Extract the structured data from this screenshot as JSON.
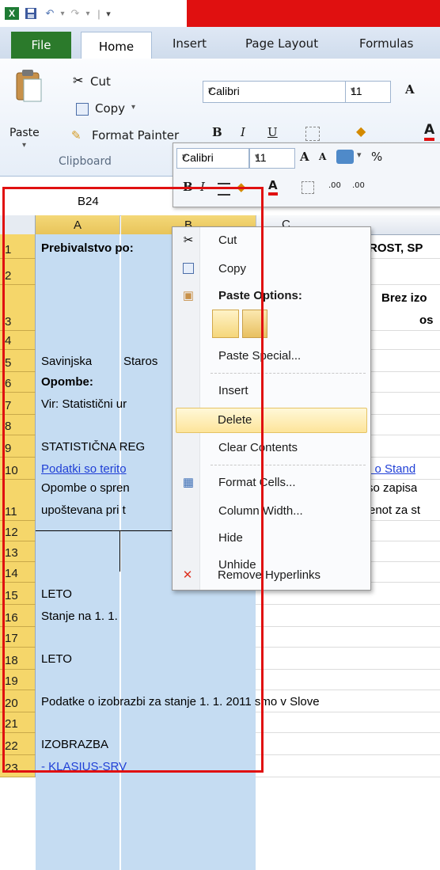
{
  "window": {
    "accent_red": "#e01010",
    "file_tab_color": "#2b7a2b"
  },
  "qat": {
    "icons": [
      "excel-app-icon",
      "save-icon",
      "undo-icon",
      "redo-icon",
      "customize-qat-icon"
    ],
    "undo_glyph": "↶",
    "redo_glyph": "↷",
    "dropdown_glyph": "▾",
    "separator_glyph": "|"
  },
  "ribbon_tabs": {
    "file": "File",
    "home": "Home",
    "insert": "Insert",
    "page_layout": "Page Layout",
    "formulas": "Formulas"
  },
  "clipboard": {
    "paste": "Paste",
    "cut": "Cut",
    "copy": "Copy",
    "format_painter": "Format Painter",
    "group_label": "Clipboard",
    "dropdown_glyph": "▾"
  },
  "font_group": {
    "font_name": "Calibri",
    "font_size": "11",
    "bold": "B",
    "italic": "I",
    "underline": "U",
    "grow": "A",
    "font_color_letter": "A"
  },
  "mini_toolbar": {
    "font_name": "Calibri",
    "font_size": "11",
    "percent": "%",
    "bold": "B",
    "italic": "I",
    "grow": "A",
    "shrink": "A",
    "font_color_letter": "A",
    "inc_decimal": ".00",
    "dec_decimal": ".00",
    "dropdown_glyph": "▾"
  },
  "name_box": {
    "value": "B24"
  },
  "grid": {
    "columns": [
      "A",
      "B",
      "C"
    ],
    "rows": [
      {
        "num": "1",
        "a": "Prebivalstvo po:",
        "c": "ROST, SP"
      },
      {
        "num": "2",
        "a": "",
        "c": ""
      },
      {
        "num": "3",
        "a": "",
        "c": "Brez izo",
        "c2": "os"
      },
      {
        "num": "4",
        "a": "",
        "c": ""
      },
      {
        "num": "5",
        "a": "Savinjska",
        "b": "Staros",
        "c": ""
      },
      {
        "num": "6",
        "a": "Opombe:",
        "c": ""
      },
      {
        "num": "7",
        "a": "Vir: Statistični ur",
        "c": ""
      },
      {
        "num": "8",
        "a": "",
        "c": ""
      },
      {
        "num": "9",
        "a": "STATISTIČNA REG",
        "c": ""
      },
      {
        "num": "10",
        "a": "Podatki so terito",
        "c": "i o Stand"
      },
      {
        "num": "11",
        "a_top": "Opombe o spren",
        "a": "upoštevana pri t",
        "c_top": "so zapisa",
        "c": "enot za st"
      },
      {
        "num": "12",
        "a": "",
        "c": ""
      },
      {
        "num": "13",
        "a": "",
        "c": ""
      },
      {
        "num": "14",
        "a": "",
        "c": ""
      },
      {
        "num": "15",
        "a": "LETO",
        "c": ""
      },
      {
        "num": "16",
        "a": "Stanje na 1. 1.",
        "c": ""
      },
      {
        "num": "17",
        "a": "",
        "c": ""
      },
      {
        "num": "18",
        "a": "LETO",
        "c": ""
      },
      {
        "num": "19",
        "a": "",
        "c": ""
      },
      {
        "num": "20",
        "a": "Podatke o izobrazbi za stanje 1. 1. 2011 smo v Slove",
        "c": ""
      },
      {
        "num": "21",
        "a": "",
        "c": ""
      },
      {
        "num": "22",
        "a": "IZOBRAZBA",
        "c": ""
      },
      {
        "num": "23",
        "a": "- KLASIUS-SRV",
        "c": ""
      }
    ]
  },
  "context_menu": {
    "cut": "Cut",
    "copy": "Copy",
    "paste_options": "Paste Options:",
    "paste_special": "Paste Special...",
    "insert": "Insert",
    "delete": "Delete",
    "clear_contents": "Clear Contents",
    "format_cells": "Format Cells...",
    "column_width": "Column Width...",
    "hide": "Hide",
    "unhide": "Unhide",
    "remove_hyperlinks": "Remove Hyperlinks"
  }
}
